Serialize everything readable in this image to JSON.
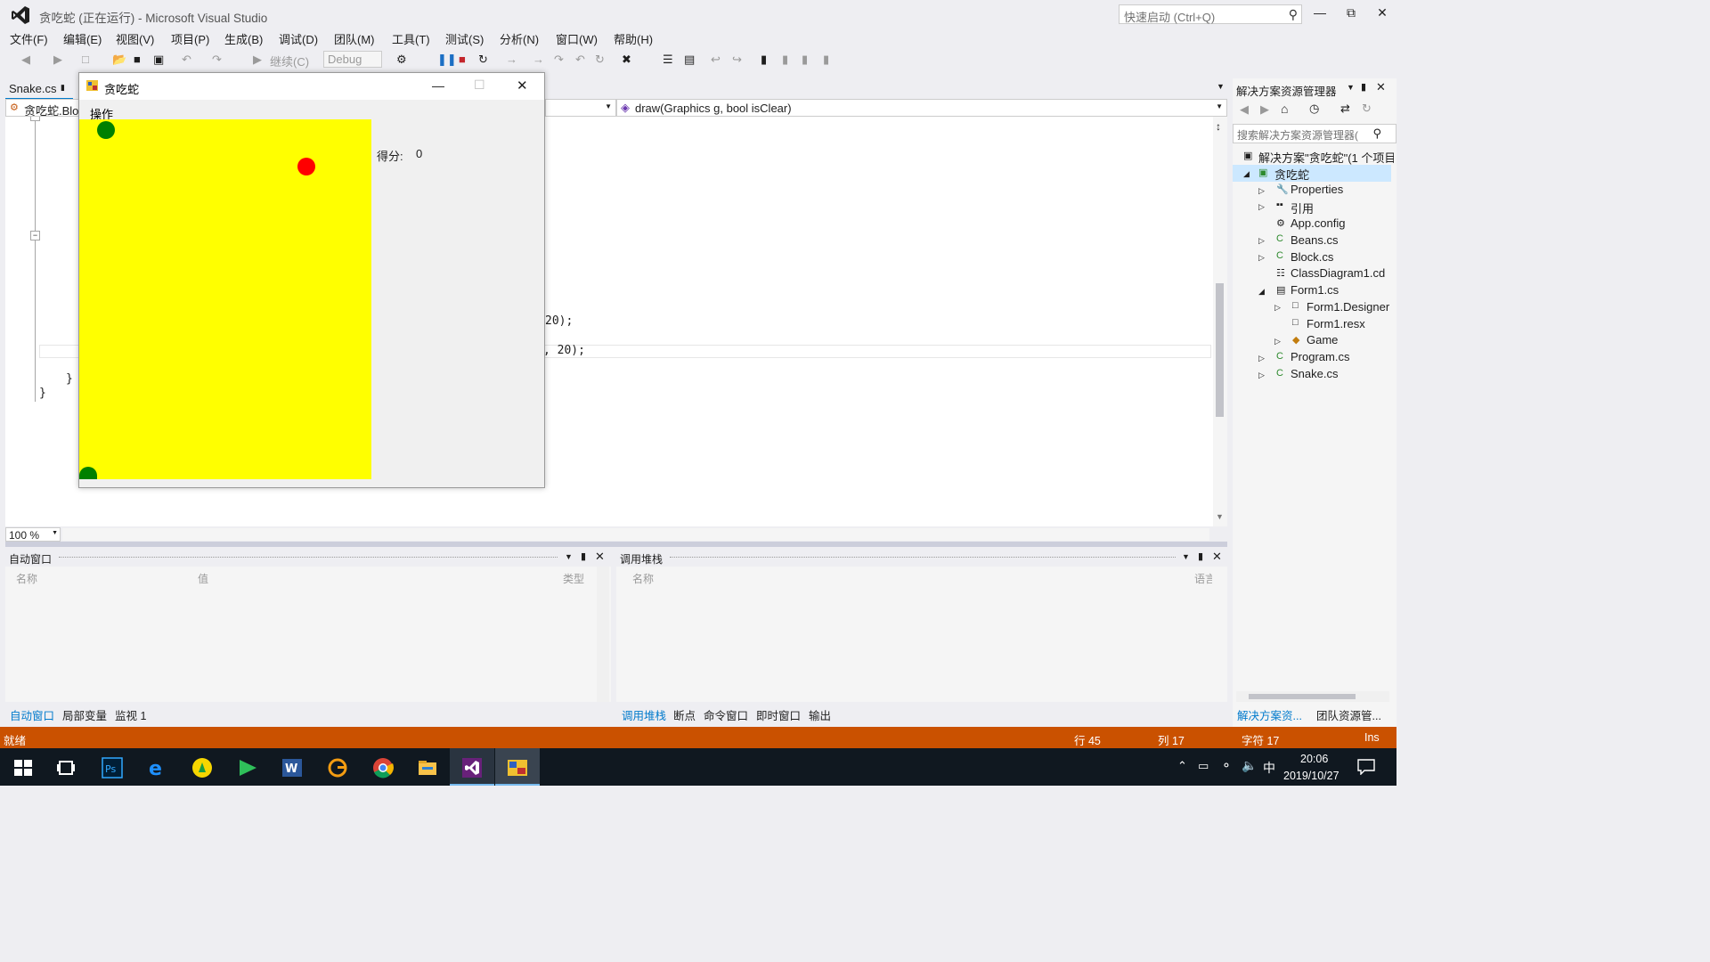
{
  "window": {
    "title": "贪吃蛇 (正在运行) - Microsoft Visual Studio",
    "quick_launch_placeholder": "快速启动 (Ctrl+Q)"
  },
  "menu": [
    "文件(F)",
    "编辑(E)",
    "视图(V)",
    "项目(P)",
    "生成(B)",
    "调试(D)",
    "团队(M)",
    "工具(T)",
    "测试(S)",
    "分析(N)",
    "窗口(W)",
    "帮助(H)"
  ],
  "toolbar": {
    "continue_label": "继续(C)",
    "config": "Debug"
  },
  "doc_tab": "Snake.cs",
  "nav": {
    "left": "贪吃蛇.Blo",
    "right": "draw(Graphics g, bool isClear)"
  },
  "code_fragments": {
    "line1": "20);",
    "line2": ",  20);",
    "brace1": "}",
    "brace2": "}"
  },
  "zoom": "100 %",
  "game": {
    "title": "贪吃蛇",
    "menu": "操作",
    "score_label": "得分:",
    "score_value": "0"
  },
  "auto_window": {
    "title": "自动窗口",
    "cols": [
      "名称",
      "值",
      "类型"
    ],
    "tabs": [
      "自动窗口",
      "局部变量",
      "监视 1"
    ]
  },
  "call_stack": {
    "title": "调用堆栈",
    "cols": [
      "名称",
      "语言"
    ],
    "tabs": [
      "调用堆栈",
      "断点",
      "命令窗口",
      "即时窗口",
      "输出"
    ]
  },
  "solution_explorer": {
    "title": "解决方案资源管理器",
    "search_placeholder": "搜索解决方案资源管理器(",
    "solution": "解决方案\"贪吃蛇\"(1 个项目)",
    "project": "贪吃蛇",
    "items": [
      "Properties",
      "引用",
      "App.config",
      "Beans.cs",
      "Block.cs",
      "ClassDiagram1.cd",
      "Form1.cs",
      "Form1.Designer",
      "Form1.resx",
      "Game",
      "Program.cs",
      "Snake.cs"
    ],
    "bottom_tabs": [
      "解决方案资...",
      "团队资源管..."
    ]
  },
  "status": {
    "ready": "就绪",
    "row": "行 45",
    "col": "列 17",
    "char": "字符 17",
    "mode": "Ins"
  },
  "taskbar": {
    "time": "20:06",
    "date": "2019/10/27",
    "ime": "中"
  },
  "colors": {
    "accent": "#007acc",
    "status_bar": "#ca5100",
    "board": "#ffff00",
    "snake": "#008000",
    "food": "#ff0000"
  }
}
